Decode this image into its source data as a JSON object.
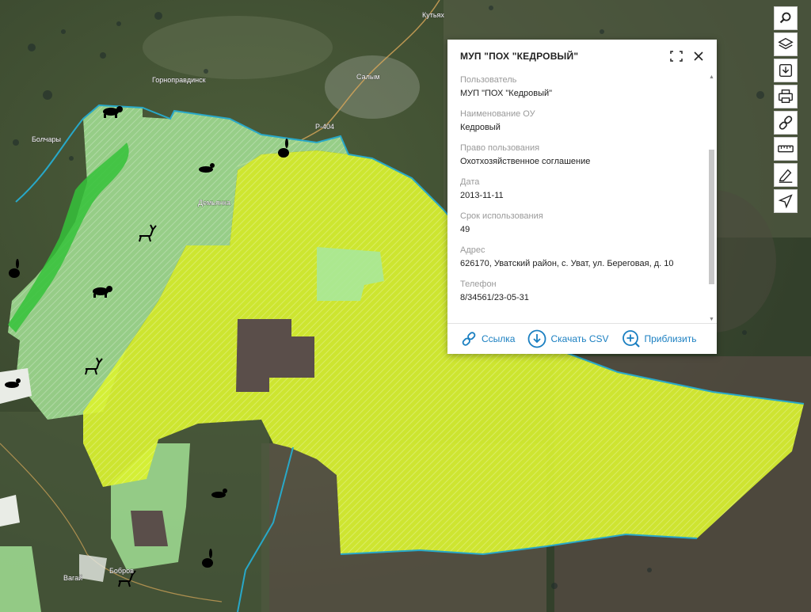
{
  "map": {
    "places": [
      "Кутьях",
      "Горноправдинск",
      "Салым",
      "Болчары",
      "Демьянка",
      "Вагай",
      "Бобров",
      "Р-404"
    ]
  },
  "toolbar": [
    {
      "name": "search-icon"
    },
    {
      "name": "layers-icon"
    },
    {
      "name": "download-icon"
    },
    {
      "name": "print-icon"
    },
    {
      "name": "link-icon"
    },
    {
      "name": "ruler-icon"
    },
    {
      "name": "pen-icon"
    },
    {
      "name": "navigation-icon"
    }
  ],
  "popup": {
    "title": "МУП \"ПОХ \"КЕДРОВЫЙ\"",
    "fields": [
      {
        "label": "Пользователь",
        "value": "МУП \"ПОХ \"Кедровый\""
      },
      {
        "label": "Наименование ОУ",
        "value": "Кедровый"
      },
      {
        "label": "Право пользования",
        "value": "Охотхозяйственное соглашение"
      },
      {
        "label": "Дата",
        "value": "2013-11-11"
      },
      {
        "label": "Срок использования",
        "value": "49"
      },
      {
        "label": "Адрес",
        "value": "626170, Уватский район, с. Уват, ул. Береговая, д. 10"
      },
      {
        "label": "Телефон",
        "value": "8/34561/23-05-31"
      }
    ],
    "actions": [
      {
        "label": "Ссылка",
        "icon": "link-icon"
      },
      {
        "label": "Скачать CSV",
        "icon": "download-circle-icon"
      },
      {
        "label": "Приблизить",
        "icon": "zoom-in-icon"
      }
    ]
  },
  "colors": {
    "yellow_area": "#d9f230",
    "green_area": "#a8e89a",
    "bright_green": "#35c23a",
    "boundary": "#28a8c8",
    "link_blue": "#1a7fc1"
  }
}
